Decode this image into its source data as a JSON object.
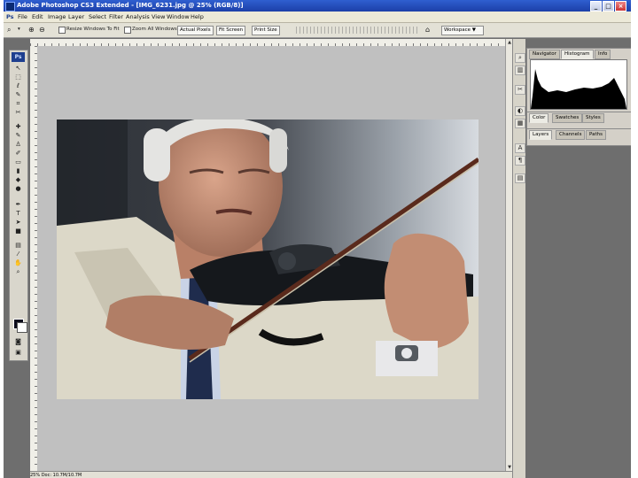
{
  "window": {
    "title": "Adobe Photoshop CS3 Extended - [IMG_6231.jpg @ 25% (RGB/8)]",
    "controls": {
      "minimize": "_",
      "maximize": "□",
      "close": "×"
    }
  },
  "menubar": {
    "items": [
      {
        "label": "Ps"
      },
      {
        "label": "File"
      },
      {
        "label": "Edit"
      },
      {
        "label": "Image"
      },
      {
        "label": "Layer"
      },
      {
        "label": "Select"
      },
      {
        "label": "Filter"
      },
      {
        "label": "Analysis"
      },
      {
        "label": "View"
      },
      {
        "label": "Window"
      },
      {
        "label": "Help"
      }
    ]
  },
  "options_bar": {
    "resize_windows_label": "Resize Windows To Fit",
    "zoom_all_windows_label": "Zoom All Windows",
    "actual_pixels_label": "Actual Pixels",
    "fit_screen_label": "Fit Screen",
    "print_size_label": "Print Size",
    "workspace_label": "Workspace ▼"
  },
  "document": {
    "zoom": "25%",
    "file": "IMG_6231.jpg",
    "status": "25%  Doc: 10.7M/10.7M"
  },
  "tools": [
    {
      "icon": "move-icon",
      "glyph": "↖"
    },
    {
      "icon": "marquee-icon",
      "glyph": "⬚"
    },
    {
      "icon": "lasso-icon",
      "glyph": "ℓ"
    },
    {
      "icon": "quick-select-icon",
      "glyph": "✎"
    },
    {
      "icon": "crop-icon",
      "glyph": "⌗"
    },
    {
      "icon": "slice-icon",
      "glyph": "✂"
    },
    {
      "icon": "healing-brush-icon",
      "glyph": "✚"
    },
    {
      "icon": "brush-icon",
      "glyph": "✎"
    },
    {
      "icon": "clone-stamp-icon",
      "glyph": "♙"
    },
    {
      "icon": "history-brush-icon",
      "glyph": "✐"
    },
    {
      "icon": "eraser-icon",
      "glyph": "▭"
    },
    {
      "icon": "gradient-icon",
      "glyph": "▮"
    },
    {
      "icon": "blur-icon",
      "glyph": "◆"
    },
    {
      "icon": "dodge-icon",
      "glyph": "●"
    },
    {
      "icon": "pen-icon",
      "glyph": "✒"
    },
    {
      "icon": "type-icon",
      "glyph": "T"
    },
    {
      "icon": "path-select-icon",
      "glyph": "➤"
    },
    {
      "icon": "shape-icon",
      "glyph": "■"
    },
    {
      "icon": "notes-icon",
      "glyph": "▤"
    },
    {
      "icon": "eyedropper-icon",
      "glyph": "⁄"
    },
    {
      "icon": "hand-icon",
      "glyph": "✋"
    },
    {
      "icon": "zoom-icon",
      "glyph": "⌕"
    }
  ],
  "dock_icons": [
    {
      "icon": "navigator-dock-icon",
      "glyph": "⌕"
    },
    {
      "icon": "histogram-dock-icon",
      "glyph": "▥"
    },
    {
      "icon": "tools-dock-icon",
      "glyph": "✂"
    },
    {
      "icon": "color-dock-icon",
      "glyph": "◐"
    },
    {
      "icon": "swatches-dock-icon",
      "glyph": "▦"
    },
    {
      "icon": "character-dock-icon",
      "glyph": "A"
    },
    {
      "icon": "paragraph-dock-icon",
      "glyph": "¶"
    },
    {
      "icon": "layers-dock-icon",
      "glyph": "▤"
    }
  ],
  "panels": {
    "group1_tabs": [
      "Navigator",
      "Histogram",
      "Info"
    ],
    "group2_tabs": [
      "Color",
      "Swatches",
      "Styles"
    ],
    "group3_tabs": [
      "Layers",
      "Channels",
      "Paths"
    ]
  },
  "colors": {
    "title_bar": "#2450c2",
    "foreground_swatch": "#0c0c1c",
    "background_swatch": "#ffffff",
    "canvas_bg": "#c0c0c0",
    "workspace_bg": "#6e6e6e"
  }
}
